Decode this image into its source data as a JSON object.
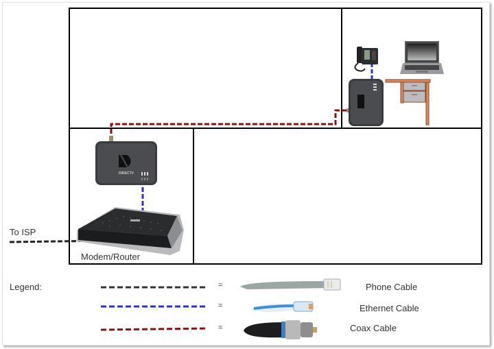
{
  "diagram": {
    "rooms": [
      {
        "id": "room-top-left"
      },
      {
        "id": "room-top-right-office"
      },
      {
        "id": "room-bottom-left-equipment"
      },
      {
        "id": "room-bottom-right"
      }
    ],
    "devices": [
      {
        "name": "DirecTV Cinema Connection Kit adapter",
        "brand": "DIRECTV",
        "room": "room-bottom-left-equipment"
      },
      {
        "name": "Modem/Router",
        "room": "room-bottom-left-equipment"
      },
      {
        "name": "DirecTV wireless adapter",
        "brand": "DIRECTV",
        "room": "room-top-right-office"
      },
      {
        "name": "IP desk phone",
        "room": "room-top-right-office"
      },
      {
        "name": "Laptop",
        "room": "room-top-right-office"
      },
      {
        "name": "Desk",
        "room": "room-top-right-office"
      }
    ],
    "labels": {
      "to_isp": "To ISP",
      "modem_router": "Modem/Router"
    },
    "connections": [
      {
        "from": "ISP",
        "to": "Modem/Router",
        "type": "Phone Cable"
      },
      {
        "from": "Modem/Router",
        "to": "DirecTV adapter (equipment room)",
        "type": "Ethernet Cable"
      },
      {
        "from": "DirecTV adapter (equipment room)",
        "to": "DirecTV adapter (office)",
        "type": "Coax Cable"
      },
      {
        "from": "DirecTV adapter (office)",
        "to": "IP desk phone",
        "type": "Ethernet Cable"
      }
    ]
  },
  "legend": {
    "title": "Legend:",
    "equals": "=",
    "items": [
      {
        "label": "Phone Cable",
        "color": "#333333"
      },
      {
        "label": "Ethernet Cable",
        "color": "#2b2bd9"
      },
      {
        "label": "Coax Cable",
        "color": "#8b1010"
      }
    ]
  },
  "colors": {
    "wall": "#000000",
    "phone_cable": "#333333",
    "ethernet_cable": "#2b2bd9",
    "coax_cable": "#8b1010",
    "desk_wood": "#d98a60",
    "device_body": "#3a3c3f"
  }
}
